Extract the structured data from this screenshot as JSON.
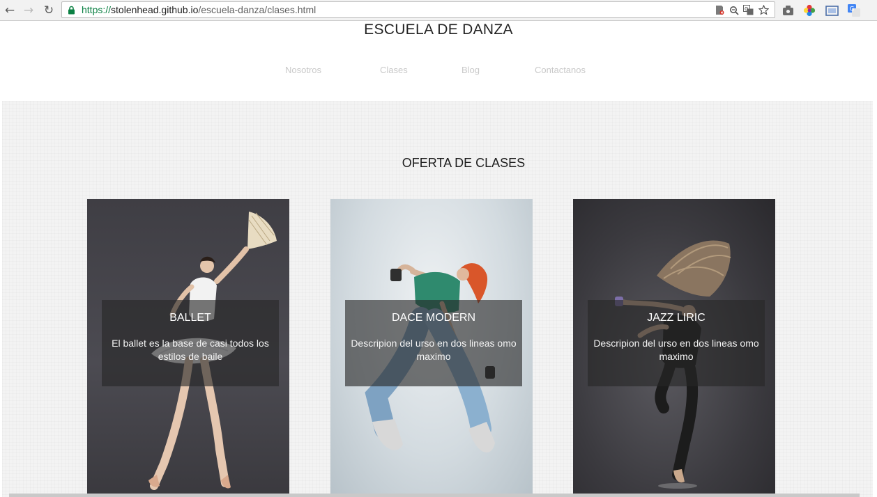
{
  "browser": {
    "url_scheme": "https://",
    "url_host": "stolenhead.github.io",
    "url_path": "/escuela-danza/clases.html"
  },
  "header": {
    "title": "ESCUELA DE DANZA",
    "nav": [
      "Nosotros",
      "Clases",
      "Blog",
      "Contactanos"
    ]
  },
  "section": {
    "title": "OFERTA DE CLASES",
    "cards": [
      {
        "name": "BALLET",
        "description": "El ballet es la base de casi todos los estilos de baile"
      },
      {
        "name": "DACE MODERN",
        "description": "Descripion del urso en dos lineas omo maximo"
      },
      {
        "name": "JAZZ LIRIC",
        "description": "Descripion del urso en dos lineas omo maximo"
      }
    ]
  },
  "icons": {
    "back": "back-arrow-icon",
    "forward": "forward-arrow-icon",
    "reload": "reload-icon",
    "lock": "lock-icon",
    "bookmark": "star-icon"
  },
  "colors": {
    "secure_green": "#0b8043",
    "nav_text": "#c9c9c9",
    "section_background": "#f3f3f3"
  }
}
